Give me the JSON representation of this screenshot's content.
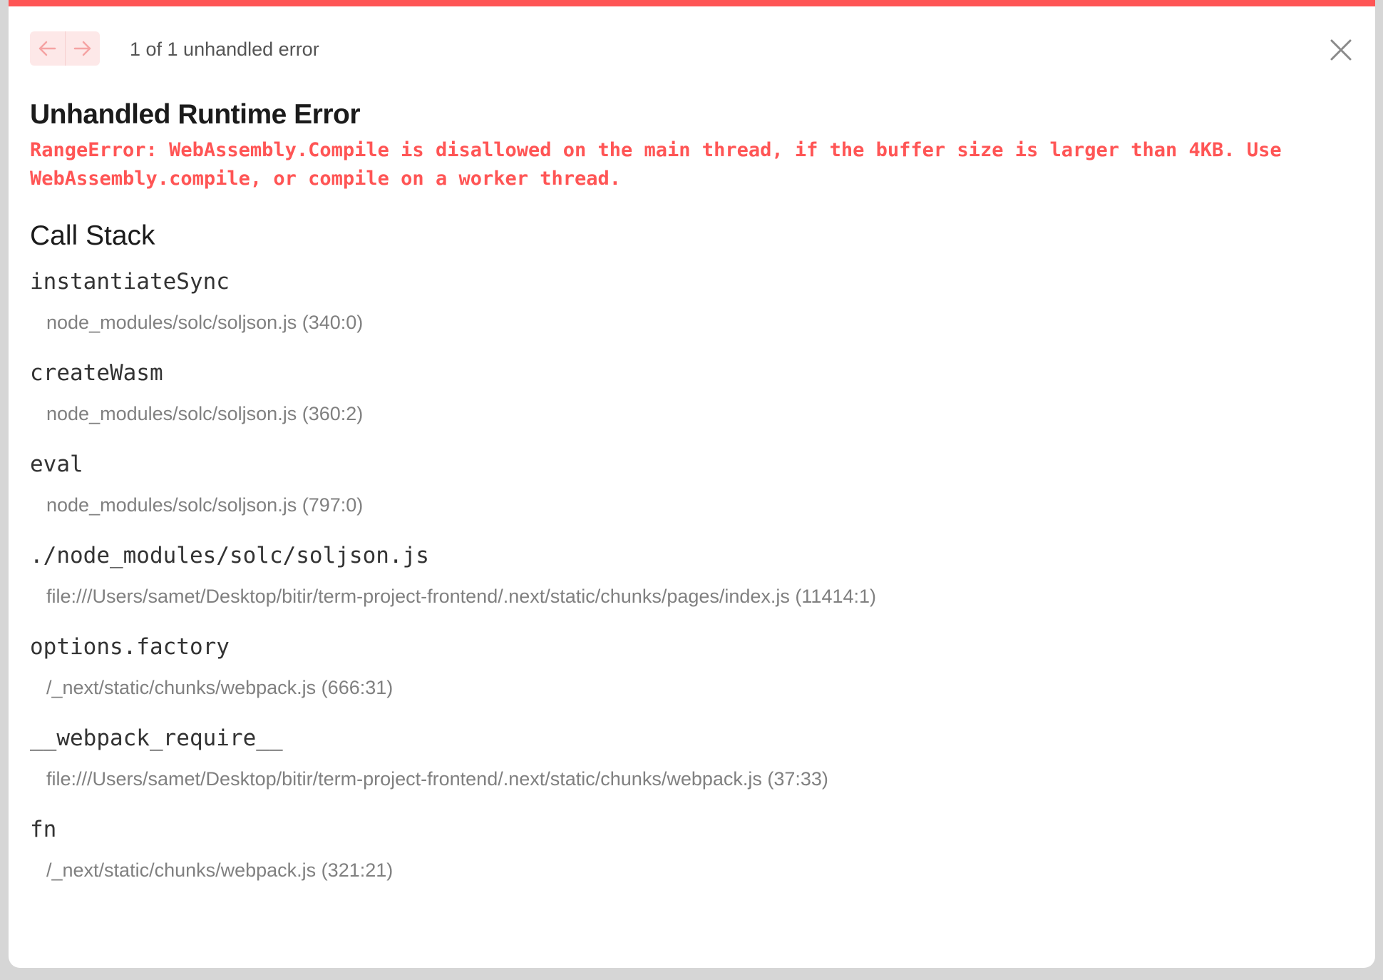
{
  "header": {
    "counter_text": "1 of 1 unhandled error"
  },
  "error": {
    "title": "Unhandled Runtime Error",
    "message": "RangeError: WebAssembly.Compile is disallowed on the main thread, if the buffer size is larger than 4KB. Use WebAssembly.compile, or compile on a worker thread."
  },
  "call_stack": {
    "title": "Call Stack",
    "frames": [
      {
        "name": "instantiateSync",
        "location": "node_modules/solc/soljson.js (340:0)"
      },
      {
        "name": "createWasm",
        "location": "node_modules/solc/soljson.js (360:2)"
      },
      {
        "name": "eval",
        "location": "node_modules/solc/soljson.js (797:0)"
      },
      {
        "name": "./node_modules/solc/soljson.js",
        "location": "file:///Users/samet/Desktop/bitir/term-project-frontend/.next/static/chunks/pages/index.js (11414:1)"
      },
      {
        "name": "options.factory",
        "location": "/_next/static/chunks/webpack.js (666:31)"
      },
      {
        "name": "__webpack_require__",
        "location": "file:///Users/samet/Desktop/bitir/term-project-frontend/.next/static/chunks/webpack.js (37:33)"
      },
      {
        "name": "fn",
        "location": "/_next/static/chunks/webpack.js (321:21)"
      }
    ]
  },
  "colors": {
    "accent": "#ff5555",
    "nav_bg": "#fde8e8",
    "text_primary": "#1b1b1b",
    "text_muted": "#808080"
  },
  "icons": {
    "prev": "arrow-left-icon",
    "next": "arrow-right-icon",
    "close": "close-icon"
  }
}
